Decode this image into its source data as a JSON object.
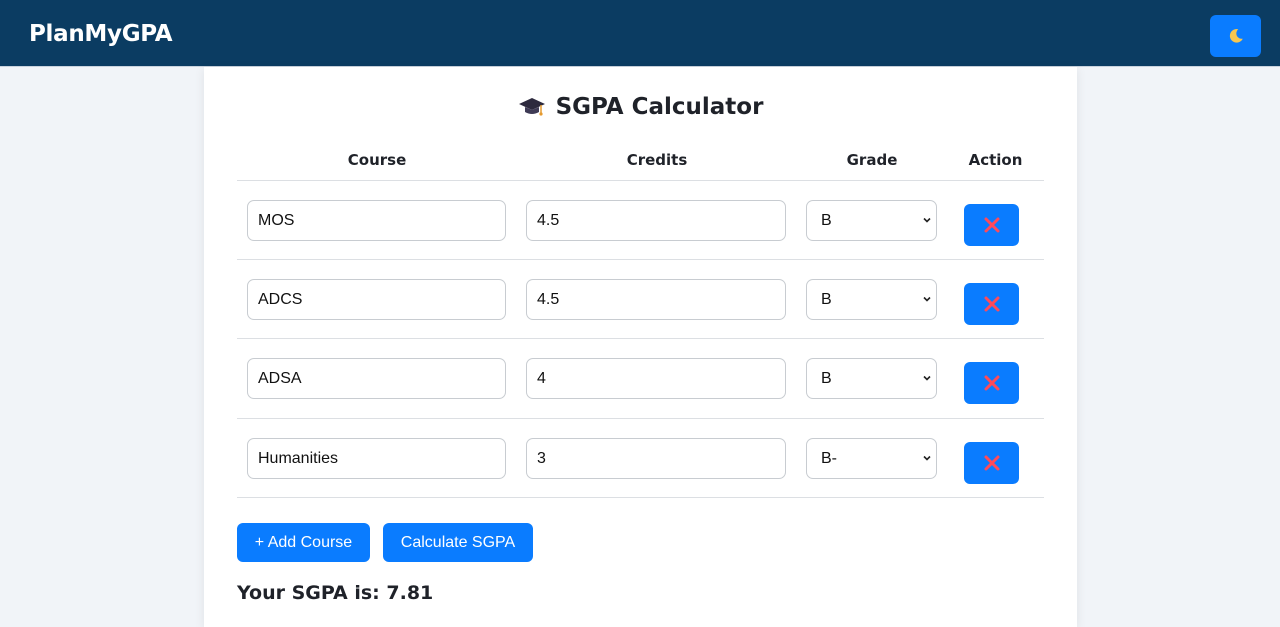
{
  "app": {
    "brand": "PlanMyGPA",
    "theme_toggle_icon": "moon-icon"
  },
  "calculator": {
    "title": "SGPA Calculator",
    "title_icon": "graduation-cap-icon",
    "headers": {
      "course": "Course",
      "credits": "Credits",
      "grade": "Grade",
      "action": "Action"
    },
    "rows": [
      {
        "course": "MOS",
        "credits": "4.5",
        "grade": "B"
      },
      {
        "course": "ADCS",
        "credits": "4.5",
        "grade": "B"
      },
      {
        "course": "ADSA",
        "credits": "4",
        "grade": "B"
      },
      {
        "course": "Humanities",
        "credits": "3",
        "grade": "B-"
      }
    ],
    "delete_icon": "cross-mark-icon",
    "add_button": "+ Add Course",
    "calculate_button": "Calculate SGPA",
    "result_label": "Your SGPA is: 7.81"
  },
  "colors": {
    "navbar": "#0b3c62",
    "accent": "#0a7cff",
    "delete_mark": "#ff4a5a"
  }
}
